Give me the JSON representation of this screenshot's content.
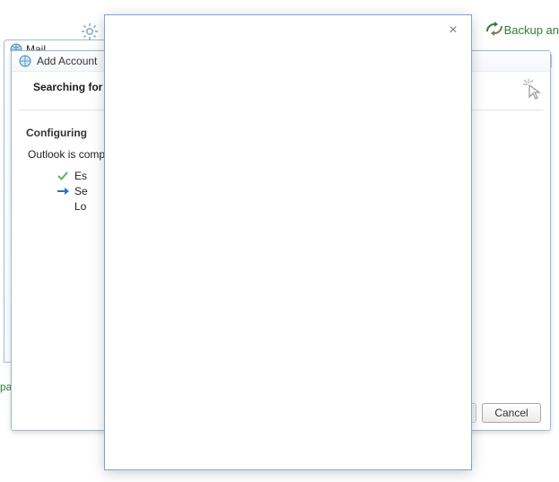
{
  "ribbon": {
    "backup_label": "Backup an"
  },
  "mail_window": {
    "title": "Mail"
  },
  "sliced_label": "pa",
  "add_account": {
    "title": "Add Account",
    "header_title": "Searching for y",
    "configuring_label": "Configuring",
    "status_text": "Outlook is comp",
    "steps": [
      {
        "icon": "check",
        "label": "Es"
      },
      {
        "icon": "arrow",
        "label": "Se"
      },
      {
        "icon": "none",
        "label": "Lo"
      }
    ],
    "cancel_label": "Cancel"
  },
  "modal": {
    "close_glyph": "×"
  }
}
